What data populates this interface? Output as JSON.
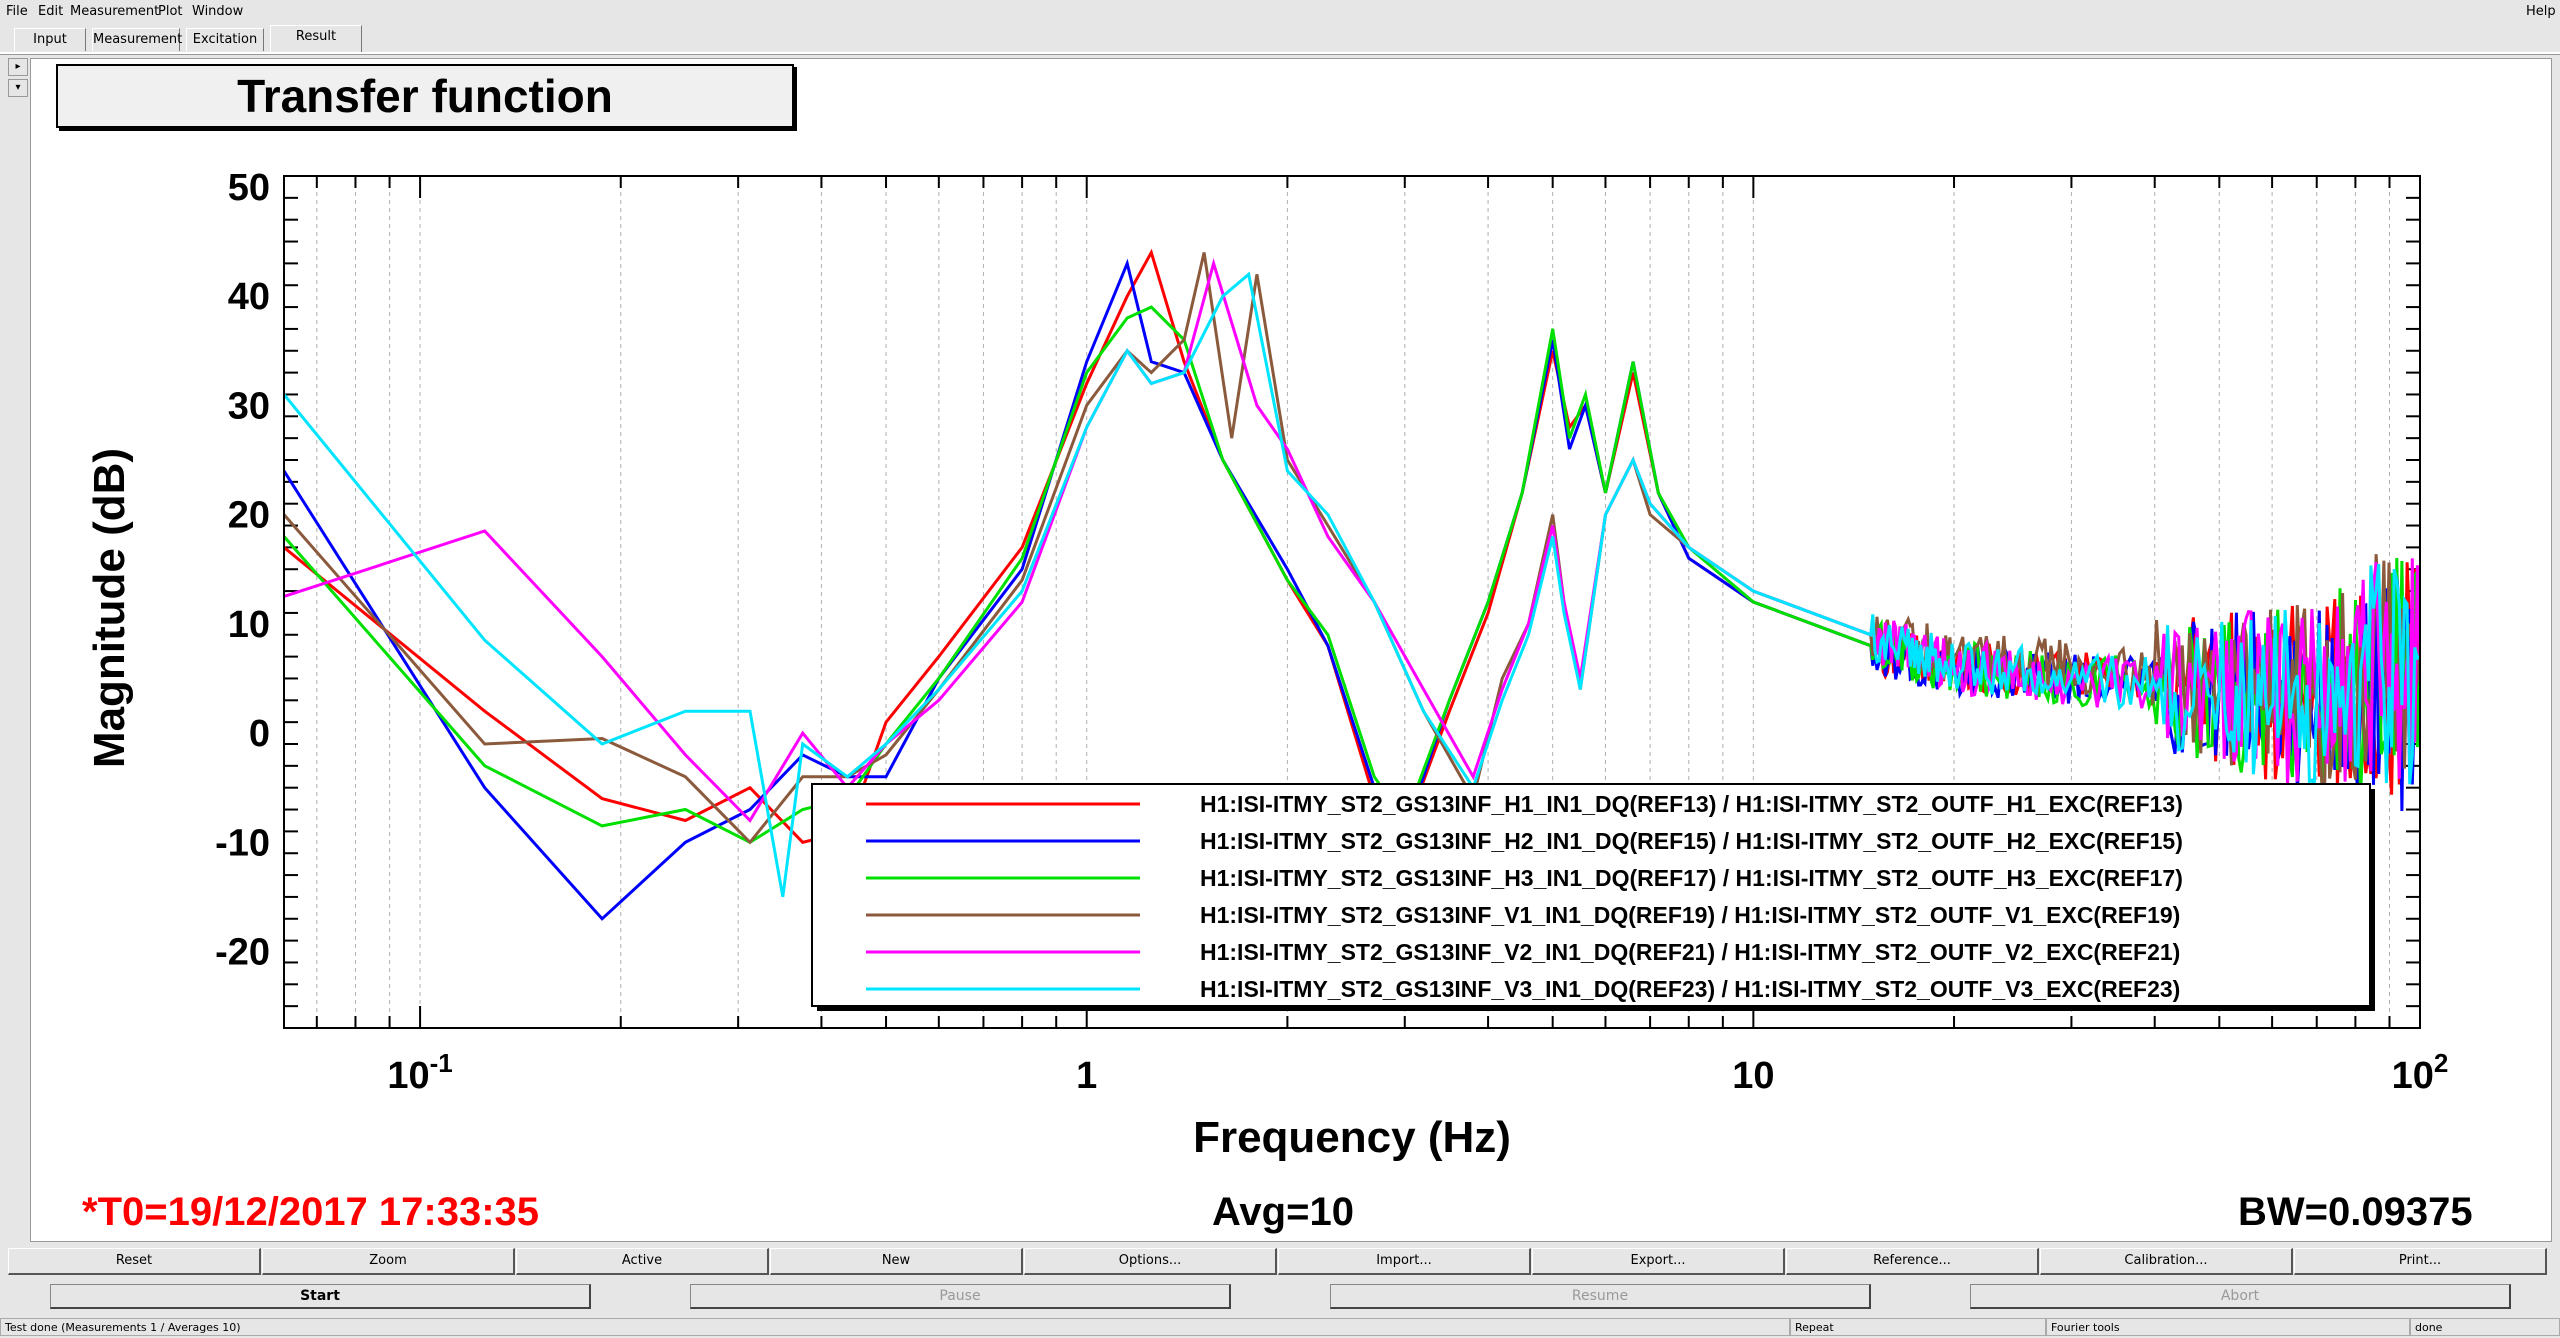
{
  "menu": {
    "file": "File",
    "edit": "Edit",
    "measurement": "Measurement",
    "plot": "Plot",
    "window": "Window",
    "help": "Help"
  },
  "tabs": [
    "Input",
    "Measurement",
    "Excitation",
    "Result"
  ],
  "plot": {
    "title": "Transfer function",
    "t0": "*T0=19/12/2017 17:33:35",
    "avg": "Avg=10",
    "bw": "BW=0.09375"
  },
  "chart_data": {
    "type": "line",
    "title": "Transfer function",
    "xlabel": "Frequency (Hz)",
    "ylabel": "Magnitude (dB)",
    "xscale": "log",
    "xlim": [
      0.0625,
      100
    ],
    "ylim": [
      -27,
      51
    ],
    "yticks": [
      -20,
      -10,
      0,
      10,
      20,
      30,
      40,
      50
    ],
    "xticks": [
      0.1,
      1,
      10,
      100
    ],
    "xtick_labels": [
      {
        "base": "10",
        "exp": "-1"
      },
      {
        "base": "1",
        "exp": ""
      },
      {
        "base": "10",
        "exp": ""
      },
      {
        "base": "10",
        "exp": "2"
      }
    ],
    "grid": true,
    "legend_position": "bottom-right",
    "series": [
      {
        "name": "H1:ISI-ITMY_ST2_GS13INF_H1_IN1_DQ(REF13) / H1:ISI-ITMY_ST2_OUTF_H1_EXC(REF13)",
        "color": "#ff0000",
        "x": [
          0.0625,
          0.125,
          0.1875,
          0.25,
          0.3125,
          0.375,
          0.4375,
          0.5,
          0.6,
          0.8,
          1.0,
          1.15,
          1.25,
          1.4,
          1.6,
          2.0,
          2.3,
          2.7,
          3.0,
          3.5,
          4.0,
          4.5,
          5.0,
          5.3,
          5.6,
          6.0,
          6.6,
          7.2,
          8,
          10,
          15,
          20,
          30,
          50,
          70,
          100
        ],
        "y": [
          17,
          2,
          -6,
          -8,
          -5,
          -10,
          -9,
          1,
          7,
          17,
          32,
          40,
          44,
          34,
          25,
          14,
          8,
          -6,
          -9,
          2,
          11,
          22,
          35,
          28,
          30,
          22,
          33,
          22,
          16,
          12,
          8,
          6,
          5,
          4,
          3,
          5
        ]
      },
      {
        "name": "H1:ISI-ITMY_ST2_GS13INF_H2_IN1_DQ(REF15) / H1:ISI-ITMY_ST2_OUTF_H2_EXC(REF15)",
        "color": "#0000ff",
        "x": [
          0.0625,
          0.125,
          0.1875,
          0.25,
          0.3125,
          0.375,
          0.4375,
          0.5,
          0.6,
          0.8,
          1.0,
          1.15,
          1.25,
          1.4,
          1.6,
          2.0,
          2.3,
          2.7,
          3.0,
          3.5,
          4.0,
          4.5,
          5.0,
          5.3,
          5.6,
          6.0,
          6.6,
          7.2,
          8,
          10,
          15,
          20,
          30,
          50,
          70,
          100
        ],
        "y": [
          24,
          -5,
          -17,
          -10,
          -7,
          -2,
          -4,
          -4,
          5,
          15,
          34,
          43,
          34,
          33,
          25,
          15,
          8,
          -5,
          -9,
          3,
          12,
          22,
          36,
          26,
          30,
          22,
          34,
          22,
          16,
          12,
          8,
          6,
          5,
          4,
          3,
          4
        ]
      },
      {
        "name": "H1:ISI-ITMY_ST2_GS13INF_H3_IN1_DQ(REF17) / H1:ISI-ITMY_ST2_OUTF_H3_EXC(REF17)",
        "color": "#00e000",
        "x": [
          0.0625,
          0.125,
          0.1875,
          0.25,
          0.3125,
          0.375,
          0.4375,
          0.5,
          0.6,
          0.8,
          1.0,
          1.15,
          1.25,
          1.4,
          1.6,
          2.0,
          2.3,
          2.7,
          3.0,
          3.5,
          4.0,
          4.5,
          5.0,
          5.3,
          5.6,
          6.0,
          6.6,
          7.2,
          8,
          10,
          15,
          20,
          30,
          50,
          70,
          100
        ],
        "y": [
          18,
          -3,
          -8.5,
          -7,
          -10,
          -7,
          -6,
          -1,
          5,
          16,
          33,
          38,
          39,
          36,
          25,
          14,
          9,
          -4,
          -8,
          3,
          12,
          22,
          37,
          27,
          31,
          22,
          34,
          22,
          17,
          12,
          8,
          6,
          5,
          4,
          3,
          6
        ]
      },
      {
        "name": "H1:ISI-ITMY_ST2_GS13INF_V1_IN1_DQ(REF19) / H1:ISI-ITMY_ST2_OUTF_V1_EXC(REF19)",
        "color": "#8b5a3c",
        "x": [
          0.0625,
          0.125,
          0.1875,
          0.25,
          0.3125,
          0.375,
          0.4375,
          0.5,
          0.6,
          0.8,
          1.0,
          1.15,
          1.25,
          1.4,
          1.5,
          1.65,
          1.8,
          2.0,
          2.3,
          2.7,
          3.2,
          3.8,
          4.2,
          4.6,
          5.0,
          5.2,
          5.5,
          6.0,
          6.6,
          7.0,
          8,
          10,
          15,
          20,
          30,
          50,
          70,
          100
        ],
        "y": [
          20,
          -1,
          -0.5,
          -4,
          -10,
          -4,
          -4,
          -2,
          4,
          14,
          30,
          35,
          33,
          36,
          44,
          27,
          42,
          25,
          19,
          12,
          2,
          -6,
          5,
          10,
          20,
          12,
          4,
          20,
          25,
          20,
          17,
          13,
          9,
          7,
          6,
          4,
          3,
          8
        ]
      },
      {
        "name": "H1:ISI-ITMY_ST2_GS13INF_V2_IN1_DQ(REF21) / H1:ISI-ITMY_ST2_OUTF_V2_EXC(REF21)",
        "color": "#ff00ff",
        "x": [
          0.0625,
          0.125,
          0.1875,
          0.25,
          0.3125,
          0.375,
          0.4375,
          0.5,
          0.6,
          0.8,
          1.0,
          1.15,
          1.25,
          1.4,
          1.55,
          1.8,
          2.0,
          2.3,
          2.7,
          3.2,
          3.8,
          4.2,
          4.6,
          5.0,
          5.2,
          5.5,
          6.0,
          6.6,
          7.0,
          8,
          10,
          15,
          20,
          30,
          50,
          70,
          100
        ],
        "y": [
          12.5,
          18.5,
          7,
          -2,
          -8,
          0,
          -5,
          -1,
          3,
          12,
          28,
          35,
          32,
          33,
          43,
          30,
          26,
          18,
          12,
          4,
          -4,
          4,
          10,
          19,
          12,
          5,
          20,
          25,
          21,
          17,
          13,
          9,
          6,
          5,
          4,
          3,
          7
        ]
      },
      {
        "name": "H1:ISI-ITMY_ST2_GS13INF_V3_IN1_DQ(REF23) / H1:ISI-ITMY_ST2_OUTF_V3_EXC(REF23)",
        "color": "#00e5ff",
        "x": [
          0.0625,
          0.125,
          0.1875,
          0.25,
          0.3125,
          0.35,
          0.375,
          0.4375,
          0.5,
          0.6,
          0.8,
          1.0,
          1.15,
          1.25,
          1.4,
          1.6,
          1.75,
          2.0,
          2.3,
          2.7,
          3.2,
          3.8,
          4.2,
          4.6,
          5.0,
          5.2,
          5.5,
          6.0,
          6.6,
          7.0,
          8,
          10,
          15,
          20,
          30,
          50,
          70,
          100
        ],
        "y": [
          31,
          8.5,
          -1,
          2,
          2,
          -15,
          -1,
          -4,
          -1,
          4,
          13,
          28,
          35,
          32,
          33,
          40,
          42,
          24,
          20,
          12,
          2,
          -5,
          3,
          9,
          18,
          11,
          4,
          20,
          25,
          21,
          17,
          13,
          9,
          6,
          5,
          4,
          3,
          7
        ]
      }
    ]
  },
  "toolbar": [
    "Reset",
    "Zoom",
    "Active",
    "New",
    "Options...",
    "Import...",
    "Export...",
    "Reference...",
    "Calibration...",
    "Print..."
  ],
  "run_buttons": {
    "start": "Start",
    "pause": "Pause",
    "resume": "Resume",
    "abort": "Abort"
  },
  "status": {
    "message": "Test done (Measurements 1 / Averages 10)",
    "repeat": "Repeat",
    "tools": "Fourier tools",
    "state": "done"
  }
}
